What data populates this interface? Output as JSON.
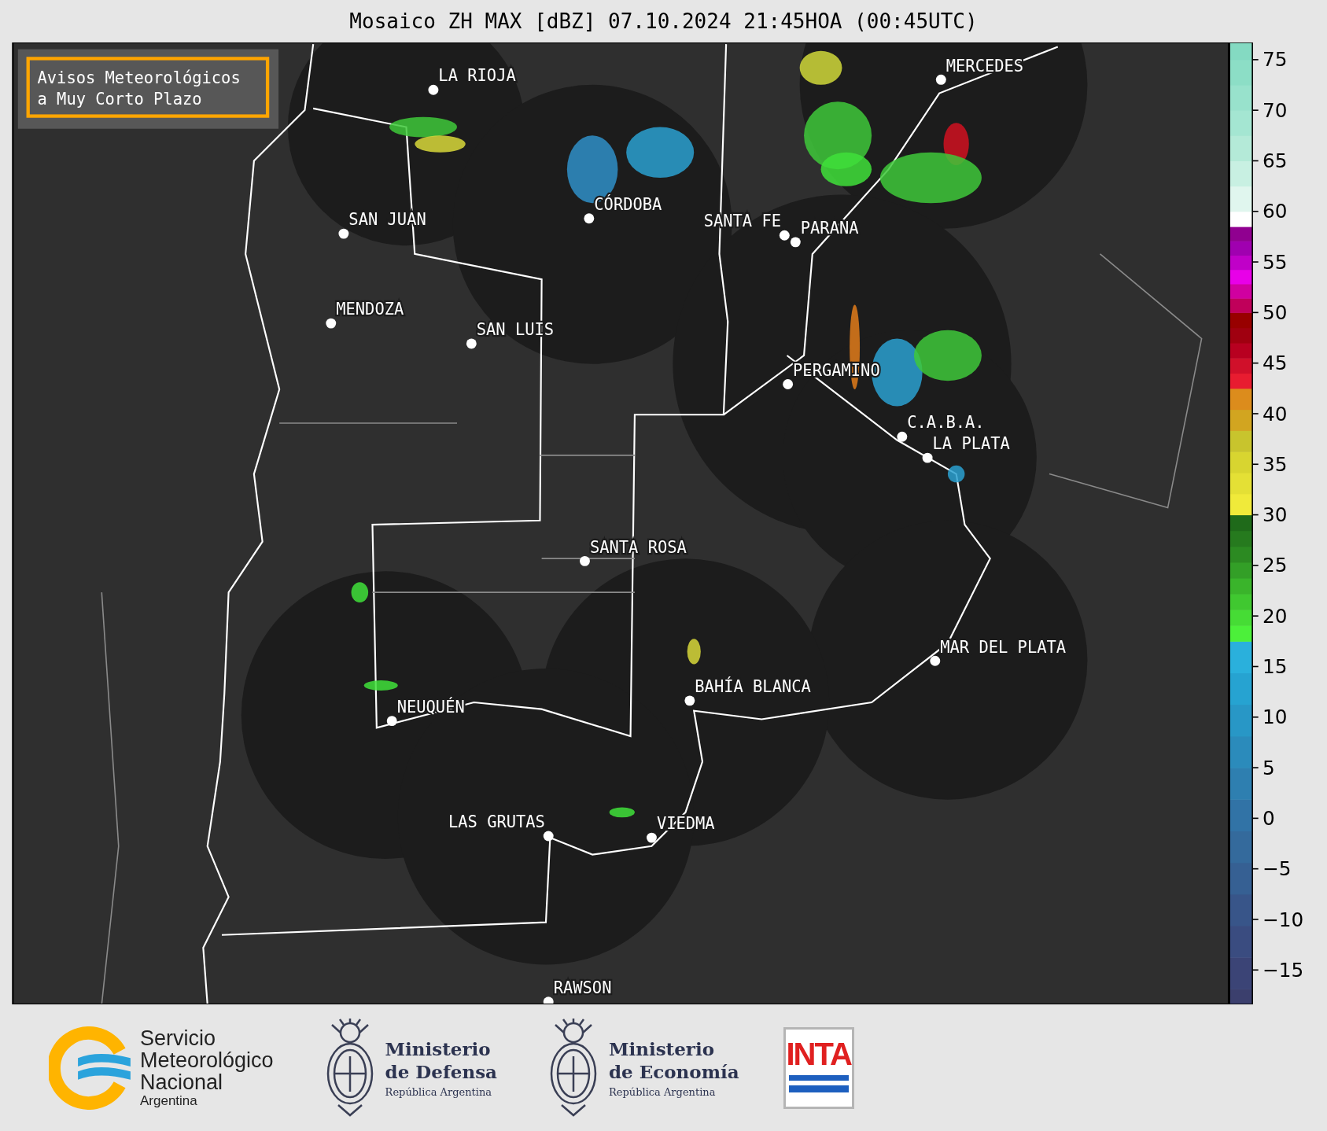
{
  "title": "Mosaico ZH MAX [dBZ] 07.10.2024 21:45HOA (00:45UTC)",
  "notice": {
    "lines": [
      "Avisos Meteorológicos",
      "a Muy Corto Plazo"
    ]
  },
  "cities": [
    {
      "name": "LA RIOJA"
    },
    {
      "name": "SAN JUAN"
    },
    {
      "name": "CÓRDOBA"
    },
    {
      "name": "SANTA FE"
    },
    {
      "name": "PARANA"
    },
    {
      "name": "MERCEDES"
    },
    {
      "name": "MENDOZA"
    },
    {
      "name": "SAN LUIS"
    },
    {
      "name": "PERGAMINO"
    },
    {
      "name": "C.A.B.A."
    },
    {
      "name": "LA PLATA"
    },
    {
      "name": "SANTA ROSA"
    },
    {
      "name": "MAR DEL PLATA"
    },
    {
      "name": "BAHÍA BLANCA"
    },
    {
      "name": "NEUQUÉN"
    },
    {
      "name": "LAS GRUTAS"
    },
    {
      "name": "VIEDMA"
    },
    {
      "name": "RAWSON"
    }
  ],
  "colorbar": {
    "ticks": [
      "75",
      "70",
      "65",
      "60",
      "55",
      "50",
      "45",
      "40",
      "35",
      "30",
      "25",
      "20",
      "15",
      "10",
      "5",
      "0",
      "−5",
      "−10",
      "−15"
    ]
  },
  "logos": [
    {
      "kind": "smn",
      "name_lines": [
        "Servicio",
        "Meteorológico",
        "Nacional"
      ],
      "country": "Argentina"
    },
    {
      "kind": "ministry",
      "name_lines": [
        "Ministerio",
        "de Defensa"
      ],
      "subtitle": "República Argentina"
    },
    {
      "kind": "ministry",
      "name_lines": [
        "Ministerio",
        "de Economía"
      ],
      "subtitle": "República Argentina"
    },
    {
      "kind": "inta",
      "text": "INTA"
    }
  ]
}
